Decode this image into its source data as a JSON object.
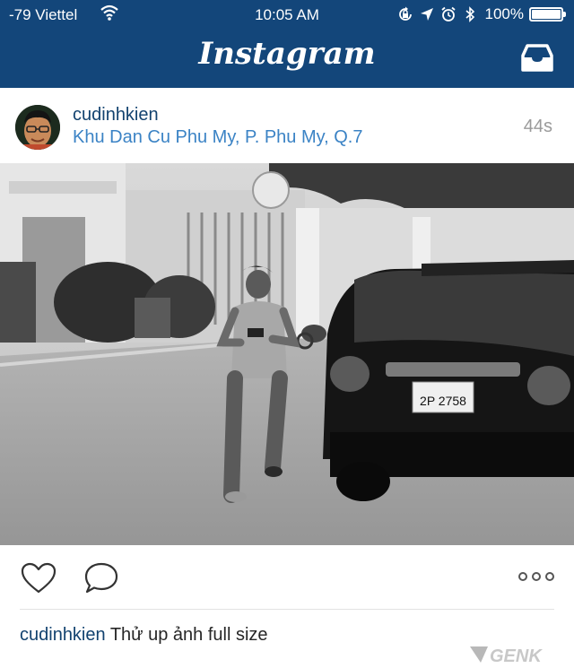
{
  "status_bar": {
    "carrier": "-79 Viettel",
    "time": "10:05 AM",
    "battery": "100%"
  },
  "nav": {
    "title": "Instagram"
  },
  "post": {
    "username": "cudinhkien",
    "location": "Khu Dan Cu Phu My, P. Phu My, Q.7",
    "time_ago": "44s",
    "caption_user": "cudinhkien",
    "caption_text": "Thử up ảnh full size",
    "license_plate": "2P 2758"
  },
  "watermark": {
    "text": "GENK"
  },
  "colors": {
    "header_bg": "#13467a",
    "username": "#12426f",
    "location": "#3b83c5",
    "muted": "#9a9a9a"
  }
}
